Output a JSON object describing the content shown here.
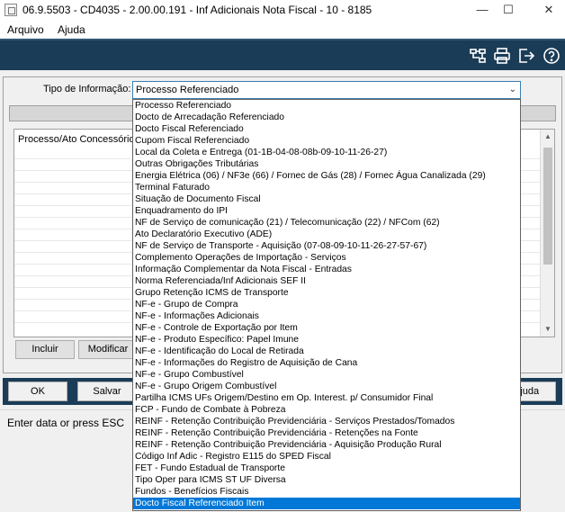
{
  "window": {
    "title": "06.9.5503 - CD4035 - 2.00.00.191 - Inf Adicionais Nota Fiscal - 10 - 8185",
    "minimize": "—",
    "maximize": "☐",
    "close": "✕"
  },
  "menu": [
    "Arquivo",
    "Ajuda"
  ],
  "toolbar": {
    "icons": [
      "tree-structure-icon",
      "printer-icon",
      "exit-icon",
      "help-icon"
    ]
  },
  "form": {
    "tipo_label": "Tipo de Informação:",
    "tipo_value": "Processo Referenciado"
  },
  "grid": {
    "header": "Processo/Ato Concessório"
  },
  "grid_buttons": {
    "incluir": "Incluir",
    "modificar": "Modificar"
  },
  "bottom_buttons": {
    "ok": "OK",
    "salvar": "Salvar",
    "ajuda": "Ajuda"
  },
  "status": "Enter data or press ESC",
  "dropdown": {
    "selected_index": 34,
    "options": [
      "Processo Referenciado",
      "Docto de Arrecadação Referenciado",
      "Docto Fiscal Referenciado",
      "Cupom Fiscal Referenciado",
      "Local da Coleta e Entrega (01-1B-04-08-08b-09-10-11-26-27)",
      "Outras Obrigações Tributárias",
      "Energia Elétrica (06) / NF3e (66) / Fornec de Gás (28) / Fornec Água Canalizada (29)",
      "Terminal Faturado",
      "Situação de Documento Fiscal",
      "Enquadramento do IPI",
      "NF de Serviço de comunicação (21) / Telecomunicação (22) / NFCom (62)",
      "Ato Declaratório Executivo (ADE)",
      "NF de Serviço de Transporte - Aquisição (07-08-09-10-11-26-27-57-67)",
      "Complemento Operações de Importação - Serviços",
      "Informação Complementar da Nota Fiscal - Entradas",
      "Norma Referenciada/Inf Adicionais SEF II",
      "Grupo Retenção ICMS de Transporte",
      "NF-e - Grupo de Compra",
      "NF-e - Informações Adicionais",
      "NF-e - Controle de Exportação por Item",
      "NF-e - Produto Específico: Papel Imune",
      "NF-e - Identificação do Local de Retirada",
      "NF-e - Informações do Registro de Aquisição de Cana",
      "NF-e - Grupo Combustível",
      "NF-e - Grupo Origem Combustível",
      "Partilha ICMS UFs Origem/Destino em Op. Interest. p/ Consumidor Final",
      "FCP - Fundo de Combate à Pobreza",
      "REINF - Retenção Contribuição Previdenciária - Serviços Prestados/Tomados",
      "REINF - Retenção Contribuição Previdenciária - Retenções na Fonte",
      "REINF - Retenção Contribuição Previdenciária - Aquisição Produção Rural",
      "Código Inf Adic - Registro E115 do SPED Fiscal",
      "FET - Fundo Estadual de Transporte",
      "Tipo Oper para ICMS ST UF Diversa",
      "Fundos - Benefícios Fiscais",
      "Docto Fiscal Referenciado Item"
    ]
  },
  "colors": {
    "toolbar_bg": "#1a3c57",
    "selection": "#0078d7",
    "combo_border": "#3c7fb1"
  }
}
